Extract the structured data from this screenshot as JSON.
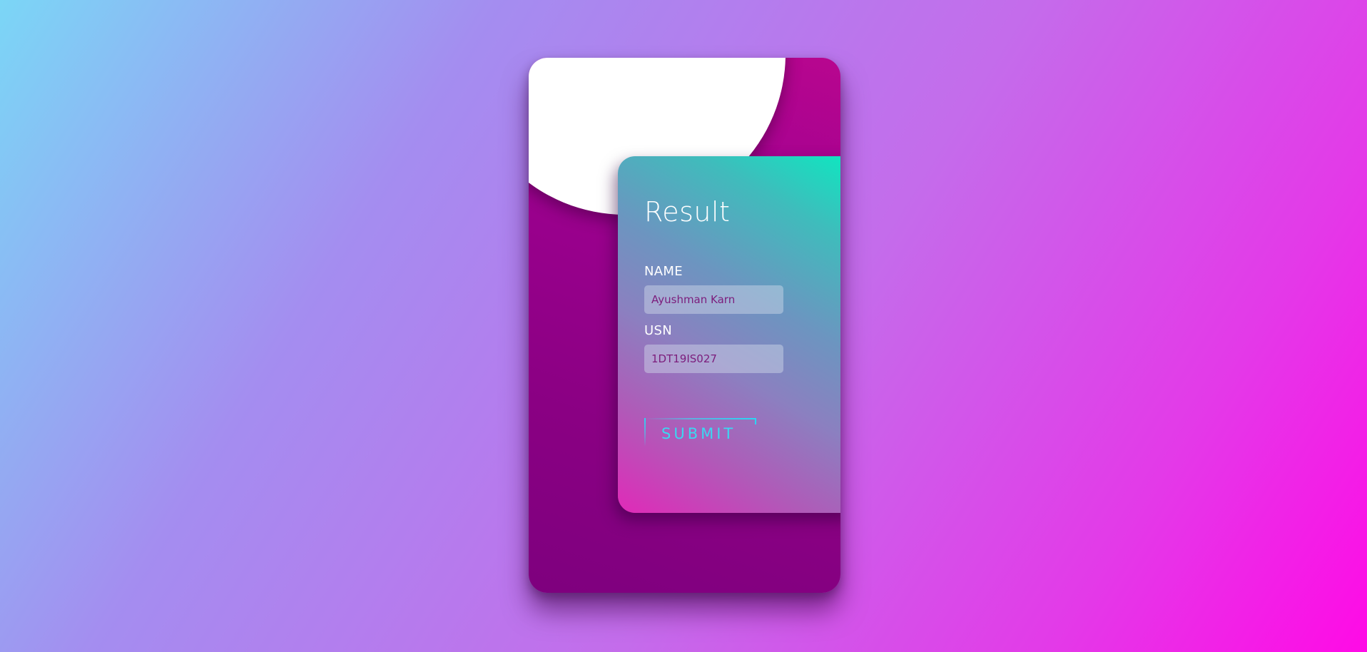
{
  "form": {
    "title": "Result",
    "name_label": "NAME",
    "name_value": "Ayushman Karn",
    "usn_label": "USN",
    "usn_value": "1DT19IS027",
    "submit_label": "SUBMIT"
  },
  "colors": {
    "background_start": "#7bd6f6",
    "background_end": "#ff0ae6",
    "card": "#9f0090",
    "panel_top": "#0de8c0",
    "panel_bottom": "#e02ab8",
    "submit_accent": "#2ad6f4",
    "input_text": "#7c1d7c"
  }
}
